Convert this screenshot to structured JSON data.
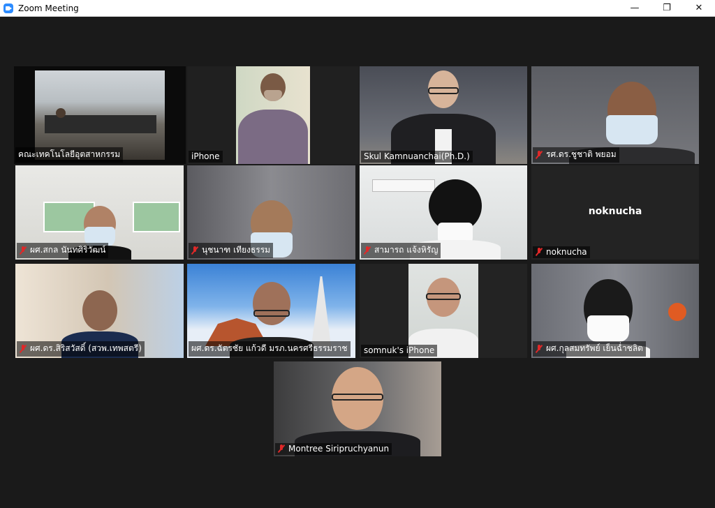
{
  "window": {
    "title": "Zoom Meeting",
    "minimize": "—",
    "maximize": "❐",
    "close": "✕"
  },
  "participants": [
    {
      "name": "คณะเทคโนโลยีอุตสาหกรรม",
      "muted": false,
      "active": true
    },
    {
      "name": "iPhone",
      "muted": false
    },
    {
      "name": "Skul Kamnuanchai(Ph.D.)",
      "muted": false
    },
    {
      "name": "รศ.ดร.ชูชาติ  พยอม",
      "muted": true
    },
    {
      "name": "ผศ.สกล  นันทศิริวัฒน์",
      "muted": true
    },
    {
      "name": "นุชนาฑ  เทียงธรรม",
      "muted": true
    },
    {
      "name": "สามารถ  แจ้งหิรัญ",
      "muted": true
    },
    {
      "name": "noknucha",
      "muted": true,
      "video_off": true,
      "center_label": "noknucha"
    },
    {
      "name": "ผศ.ดร.สิริสวัสดิ์ (สวพ.เทพสตรี)",
      "muted": true
    },
    {
      "name": "ผศ.ดร.ฉัตรชัย แก้วดี มรภ.นครศรีธรรมราช",
      "muted": true
    },
    {
      "name": "somnuk's iPhone",
      "muted": false
    },
    {
      "name": "ผศ.กุลสมทรัพย์  เย็นฉ่ำชลิต",
      "muted": true
    },
    {
      "name": "Montree Siripruchyanun",
      "muted": true
    }
  ],
  "colors": {
    "active_border": "#c9e37a",
    "mute": "#e02828",
    "background": "#1a1a1a"
  }
}
